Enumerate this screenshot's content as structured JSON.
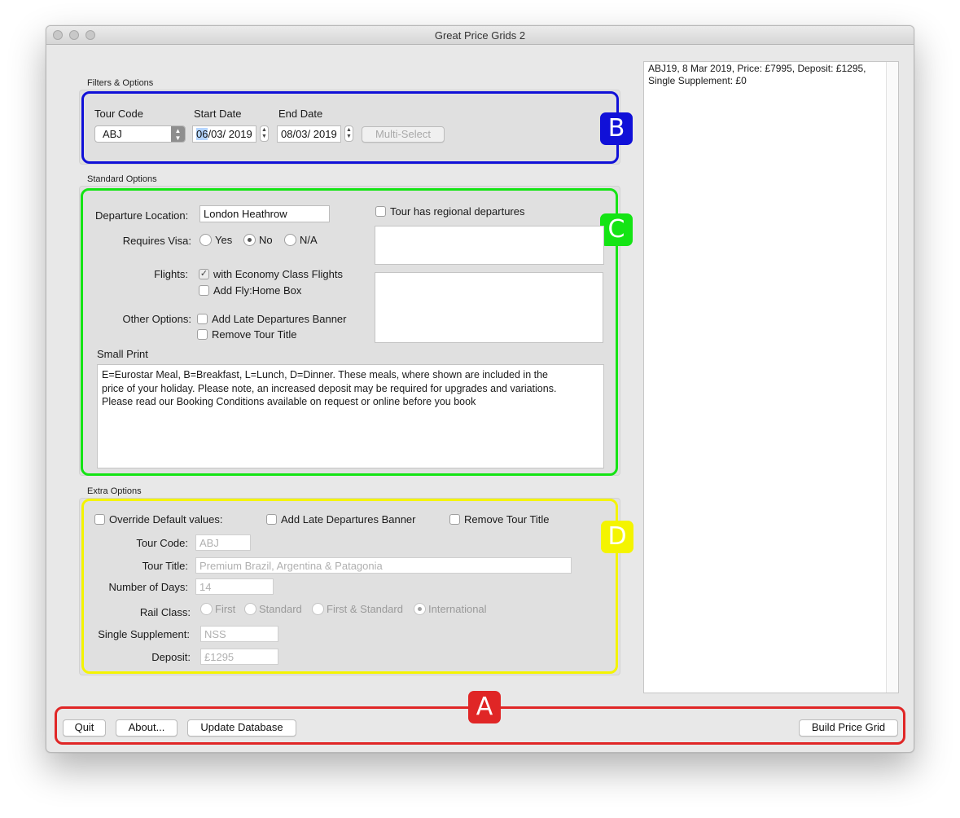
{
  "window": {
    "title": "Great Price Grids 2"
  },
  "sections": {
    "filters_label": "Filters & Options",
    "standard_label": "Standard Options",
    "extra_label": "Extra Options"
  },
  "badges": {
    "a": "A",
    "b": "B",
    "c": "C",
    "d": "D"
  },
  "colors": {
    "a": "#e02626",
    "b": "#1010d8",
    "c": "#14e414",
    "d": "#f4f400"
  },
  "filters": {
    "tour_code_label": "Tour Code",
    "tour_code_value": "ABJ",
    "start_date_label": "Start Date",
    "start_date_day": "06",
    "start_date_rest": "/03/ 2019",
    "end_date_label": "End Date",
    "end_date_value": "08/03/ 2019",
    "multi_select": "Multi-Select"
  },
  "standard": {
    "departure_location_label": "Departure Location:",
    "departure_location_value": "London Heathrow",
    "regional_departures": "Tour has regional departures",
    "requires_visa_label": "Requires Visa:",
    "visa_yes": "Yes",
    "visa_no": "No",
    "visa_na": "N/A",
    "flights_label": "Flights:",
    "economy_flights": "with Economy Class Flights",
    "fly_home_box": "Add Fly:Home Box",
    "other_options_label": "Other Options:",
    "late_departures": "Add Late Departures Banner",
    "remove_title": "Remove Tour Title",
    "small_print_label": "Small Print",
    "small_print_line1": "E=Eurostar Meal, B=Breakfast, L=Lunch, D=Dinner. These meals, where shown are included in the",
    "small_print_line2": "price of your holiday. Please note, an increased deposit may be required for upgrades and variations.",
    "small_print_line3": "Please read our Booking Conditions available on request or online before you book"
  },
  "extra": {
    "override_defaults": "Override Default values:",
    "late_departures": "Add Late Departures Banner",
    "remove_title": "Remove Tour Title",
    "tour_code_label": "Tour Code:",
    "tour_code_value": "ABJ",
    "tour_title_label": "Tour Title:",
    "tour_title_value": "Premium Brazil, Argentina & Patagonia",
    "days_label": "Number of Days:",
    "days_value": "14",
    "rail_class_label": "Rail Class:",
    "rail_first": "First",
    "rail_standard": "Standard",
    "rail_first_standard": "First & Standard",
    "rail_international": "International",
    "single_supplement_label": "Single Supplement:",
    "single_supplement_value": "NSS",
    "deposit_label": "Deposit:",
    "deposit_value": "£1295"
  },
  "output": {
    "line1": "ABJ19, 8 Mar 2019, Price: £7995, Deposit: £1295,",
    "line2": "Single Supplement: £0"
  },
  "footer": {
    "quit": "Quit",
    "about": "About...",
    "update_db": "Update Database",
    "build": "Build Price Grid"
  }
}
